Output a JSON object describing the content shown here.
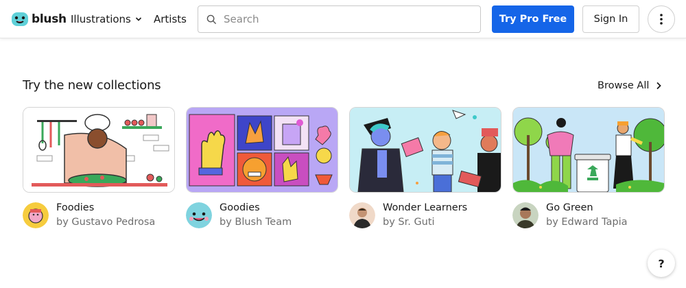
{
  "header": {
    "logo_text": "blush",
    "nav": {
      "illustrations": "Illustrations",
      "artists": "Artists"
    },
    "search_placeholder": "Search",
    "try_pro": "Try Pro Free",
    "sign_in": "Sign In"
  },
  "section": {
    "title": "Try the new collections",
    "browse_all": "Browse All"
  },
  "collections": [
    {
      "name": "Foodies",
      "author": "by Gustavo Pedrosa"
    },
    {
      "name": "Goodies",
      "author": "by Blush Team"
    },
    {
      "name": "Wonder Learners",
      "author": "by Sr. Guti"
    },
    {
      "name": "Go Green",
      "author": "by Edward Tapia"
    }
  ],
  "help_label": "?",
  "colors": {
    "primary": "#1565e8",
    "logo": "#5fd0d8"
  }
}
